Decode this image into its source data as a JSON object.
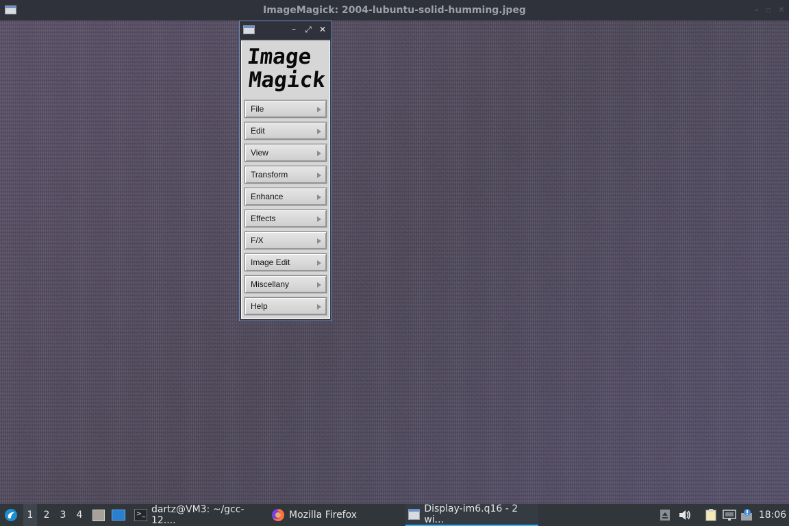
{
  "main_window": {
    "title": "ImageMagick: 2004-lubuntu-solid-humming.jpeg",
    "controls": [
      "–",
      "▫",
      "✕"
    ]
  },
  "command_window": {
    "controls": {
      "minimize": "–",
      "maximize": "⤢",
      "close": "✕"
    },
    "logo": {
      "line1": "Image",
      "line2": "Magick"
    },
    "menu_items": [
      {
        "label": "File"
      },
      {
        "label": "Edit"
      },
      {
        "label": "View"
      },
      {
        "label": "Transform"
      },
      {
        "label": "Enhance"
      },
      {
        "label": "Effects"
      },
      {
        "label": "F/X"
      },
      {
        "label": "Image Edit"
      },
      {
        "label": "Miscellany"
      },
      {
        "label": "Help"
      }
    ]
  },
  "taskbar": {
    "desktops": [
      "1",
      "2",
      "3",
      "4"
    ],
    "active_desktop": "1",
    "tasks": [
      {
        "label": "dartz@VM3: ~/gcc-12....",
        "icon": "terminal-icon"
      },
      {
        "label": "Mozilla Firefox",
        "icon": "firefox-icon"
      },
      {
        "label": "Display-im6.q16 - 2 wi...",
        "icon": "window-icon",
        "active": true
      }
    ],
    "clock": "18:06"
  },
  "colors": {
    "accent": "#3daee9",
    "window_border": "#6d8fc7",
    "titlebar": "#2f323a"
  }
}
